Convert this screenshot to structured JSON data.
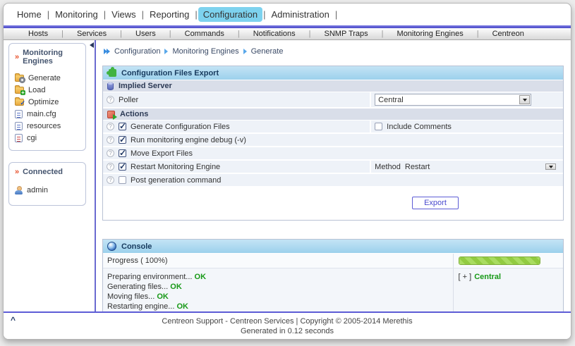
{
  "topnav": {
    "items": [
      {
        "label": "Home",
        "active": false
      },
      {
        "label": "Monitoring",
        "active": false
      },
      {
        "label": "Views",
        "active": false
      },
      {
        "label": "Reporting",
        "active": false
      },
      {
        "label": "Configuration",
        "active": true
      },
      {
        "label": "Administration",
        "active": false
      }
    ]
  },
  "tabs": {
    "items": [
      "Hosts",
      "Services",
      "Users",
      "Commands",
      "Notifications",
      "SNMP Traps",
      "Monitoring Engines",
      "Centreon"
    ]
  },
  "sidebar": {
    "section1": {
      "title": "Monitoring Engines",
      "items": [
        {
          "label": "Generate",
          "icon": "folder-gear-icon"
        },
        {
          "label": "Load",
          "icon": "folder-plus-icon"
        },
        {
          "label": "Optimize",
          "icon": "folder-check-icon"
        },
        {
          "label": "main.cfg",
          "icon": "config-file-icon"
        },
        {
          "label": "resources",
          "icon": "config-file-icon"
        },
        {
          "label": "cgi",
          "icon": "cgi-file-icon"
        }
      ]
    },
    "section2": {
      "title": "Connected",
      "user": "admin",
      "icon": "user-icon"
    }
  },
  "breadcrumb": {
    "items": [
      "Configuration",
      "Monitoring Engines",
      "Generate"
    ]
  },
  "export_panel": {
    "title": "Configuration Files Export",
    "icon": "puzzle-icon",
    "implied_server": {
      "title": "Implied Server",
      "icon": "database-icon",
      "poller_label": "Poller",
      "poller_value": "Central"
    },
    "actions": {
      "title": "Actions",
      "icon": "actions-icon",
      "rows": [
        {
          "label": "Generate Configuration Files",
          "checked": true
        },
        {
          "label": "Run monitoring engine debug (-v)",
          "checked": true
        },
        {
          "label": "Move Export Files",
          "checked": true
        },
        {
          "label": "Restart Monitoring Engine",
          "checked": true
        },
        {
          "label": "Post generation command",
          "checked": false
        }
      ],
      "include_comments": {
        "label": "Include Comments",
        "checked": false
      },
      "method": {
        "label": "Method",
        "value": "Restart"
      }
    },
    "export_button": "Export"
  },
  "console": {
    "title": "Console",
    "icon": "globe-icon",
    "progress_label": "Progress ( 100%)",
    "progress_percent": 100,
    "logs": [
      {
        "text": "Preparing environment...",
        "status": "OK"
      },
      {
        "text": "Generating files...",
        "status": "OK"
      },
      {
        "text": "Moving files...",
        "status": "OK"
      },
      {
        "text": "Restarting engine...",
        "status": "OK"
      }
    ],
    "tree": {
      "expander": "[ + ]",
      "name": "Central"
    }
  },
  "footer": {
    "line1": "Centreon Support - Centreon Services | Copyright © 2005-2014 Merethis",
    "line2": "Generated in 0.12 seconds"
  },
  "colors": {
    "accent_indigo": "#5d5cd6",
    "active_tab_cyan": "#7dd2ee",
    "panel_header_blue": "#a9d9f0",
    "subheader_gray": "#d9dee9",
    "ok_green": "#179917",
    "progress_green": "#97cf4e"
  }
}
